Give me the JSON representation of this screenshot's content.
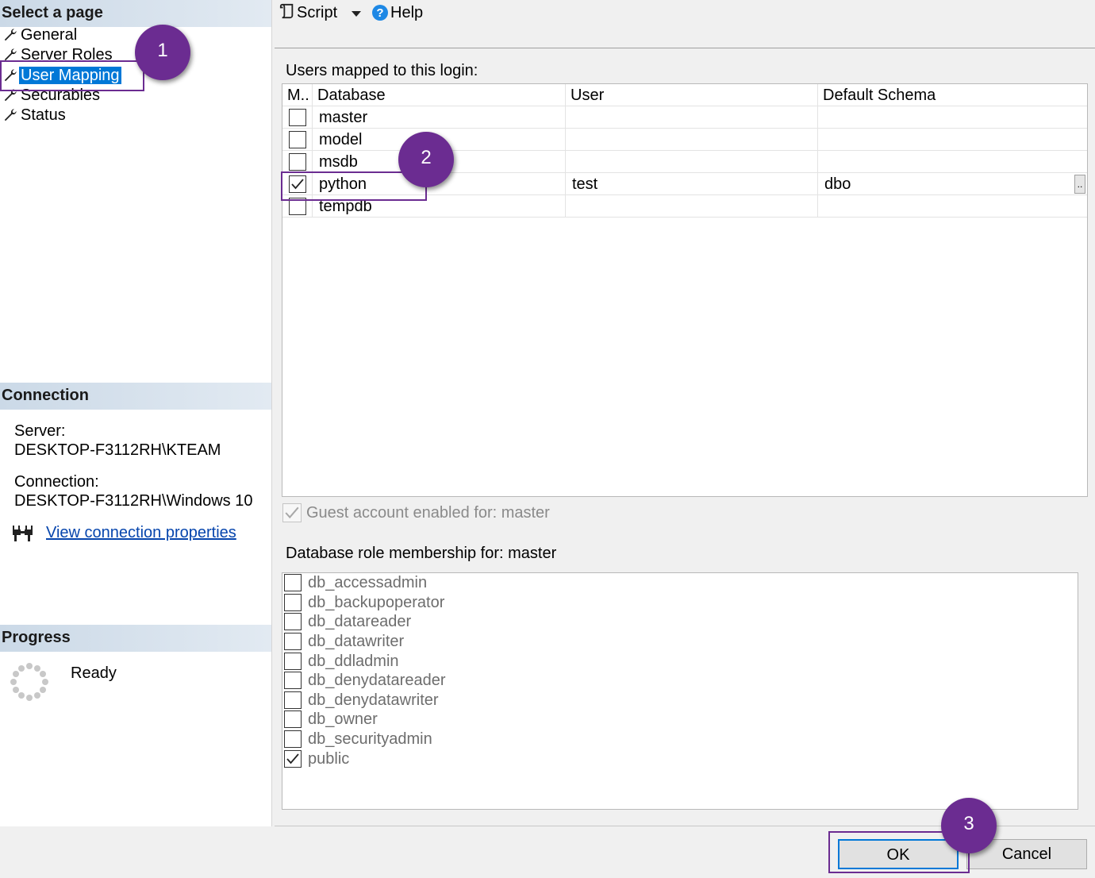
{
  "left": {
    "select_page_header": "Select a page",
    "pages": [
      {
        "label": "General",
        "selected": false
      },
      {
        "label": "Server Roles",
        "selected": false
      },
      {
        "label": "User Mapping",
        "selected": true
      },
      {
        "label": "Securables",
        "selected": false
      },
      {
        "label": "Status",
        "selected": false
      }
    ],
    "connection_header": "Connection",
    "server_label": "Server:",
    "server_value": "DESKTOP-F3112RH\\KTEAM",
    "connection_label": "Connection:",
    "connection_value": "DESKTOP-F3112RH\\Windows 10",
    "view_connection_link": "View connection properties",
    "progress_header": "Progress",
    "progress_status": "Ready"
  },
  "toolbar": {
    "script_label": "Script",
    "help_label": "Help"
  },
  "mapping": {
    "title": "Users mapped to this login:",
    "columns": [
      "M..",
      "Database",
      "User",
      "Default Schema"
    ],
    "rows": [
      {
        "map": false,
        "database": "master",
        "user": "",
        "schema": ""
      },
      {
        "map": false,
        "database": "model",
        "user": "",
        "schema": ""
      },
      {
        "map": false,
        "database": "msdb",
        "user": "",
        "schema": ""
      },
      {
        "map": true,
        "database": "python",
        "user": "test",
        "schema": "dbo",
        "ellipsis": ".."
      },
      {
        "map": false,
        "database": "tempdb",
        "user": "",
        "schema": ""
      }
    ]
  },
  "guest": {
    "label": "Guest account enabled for: master",
    "checked": true,
    "disabled": true
  },
  "roles": {
    "title": "Database role membership for: master",
    "items": [
      {
        "label": "db_accessadmin",
        "checked": false
      },
      {
        "label": "db_backupoperator",
        "checked": false
      },
      {
        "label": "db_datareader",
        "checked": false
      },
      {
        "label": "db_datawriter",
        "checked": false
      },
      {
        "label": "db_ddladmin",
        "checked": false
      },
      {
        "label": "db_denydatareader",
        "checked": false
      },
      {
        "label": "db_denydatawriter",
        "checked": false
      },
      {
        "label": "db_owner",
        "checked": false
      },
      {
        "label": "db_securityadmin",
        "checked": false
      },
      {
        "label": "public",
        "checked": true
      }
    ]
  },
  "buttons": {
    "ok": "OK",
    "cancel": "Cancel"
  },
  "annotations": {
    "step1": "1",
    "step2": "2",
    "step3": "3",
    "color": "#6b2c91"
  },
  "colors": {
    "selection": "#0078d7",
    "link": "#0645ad",
    "header_gradient": "#cbd9e7"
  }
}
